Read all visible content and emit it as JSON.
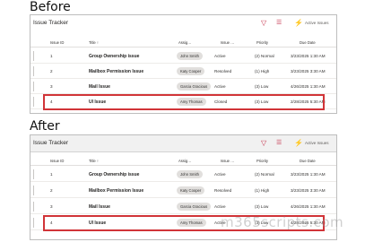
{
  "before_label": "Before",
  "after_label": "After",
  "app": {
    "title": "Issue Tracker",
    "view_label": "Active Issues",
    "icons": [
      "filter-icon",
      "list-view-icon",
      "flow-icon"
    ]
  },
  "columns": [
    {
      "label": "Issue ID",
      "sort": "˅"
    },
    {
      "label": "Title ↑",
      "sort": "˅"
    },
    {
      "label": "Assig…",
      "sort": "˅"
    },
    {
      "label": "Issue …",
      "sort": "˅"
    },
    {
      "label": "Priority",
      "sort": "˅"
    },
    {
      "label": "Due Date",
      "sort": "˅"
    }
  ],
  "before_rows": [
    {
      "id": "1",
      "title": "Group Ownership issue",
      "assignee": "John Smith",
      "status": "Active",
      "priority": "(2) Normal",
      "due": "3/23/2025 1:30 AM"
    },
    {
      "id": "2",
      "title": "Mailbox Permission Issue",
      "assignee": "Katy Cooper",
      "status": "Resolved",
      "priority": "(1) High",
      "due": "3/23/2025 3:30 AM"
    },
    {
      "id": "3",
      "title": "Mail Issue",
      "assignee": "Garcia Gracious",
      "status": "Active",
      "priority": "(3) Low",
      "due": "4/26/2025 1:30 AM"
    },
    {
      "id": "4",
      "title": "UI Issue",
      "assignee": "Amy Thomas",
      "status": "Closed",
      "priority": "(3) Low",
      "due": "2/28/2025 5:30 AM"
    }
  ],
  "after_rows": [
    {
      "id": "1",
      "title": "Group Ownership issue",
      "assignee": "John Smith",
      "status": "Active",
      "priority": "(2) Normal",
      "due": "3/23/2025 1:30 AM"
    },
    {
      "id": "2",
      "title": "Mailbox Permission Issue",
      "assignee": "Katy Cooper",
      "status": "Resolved",
      "priority": "(1) High",
      "due": "3/23/2025 3:30 AM"
    },
    {
      "id": "3",
      "title": "Mail Issue",
      "assignee": "Garcia Gracious",
      "status": "Active",
      "priority": "(3) Low",
      "due": "4/26/2025 1:30 AM"
    },
    {
      "id": "4",
      "title": "UI Issue",
      "assignee": "Amy Thomas",
      "status": "Active",
      "priority": "(3) Low",
      "due": "4/28/2025 5:30 AM"
    }
  ],
  "watermark": "m365scripts.com",
  "colors": {
    "highlight": "#d13438",
    "accent": "#c4314b",
    "pill": "#e1dfdd"
  }
}
